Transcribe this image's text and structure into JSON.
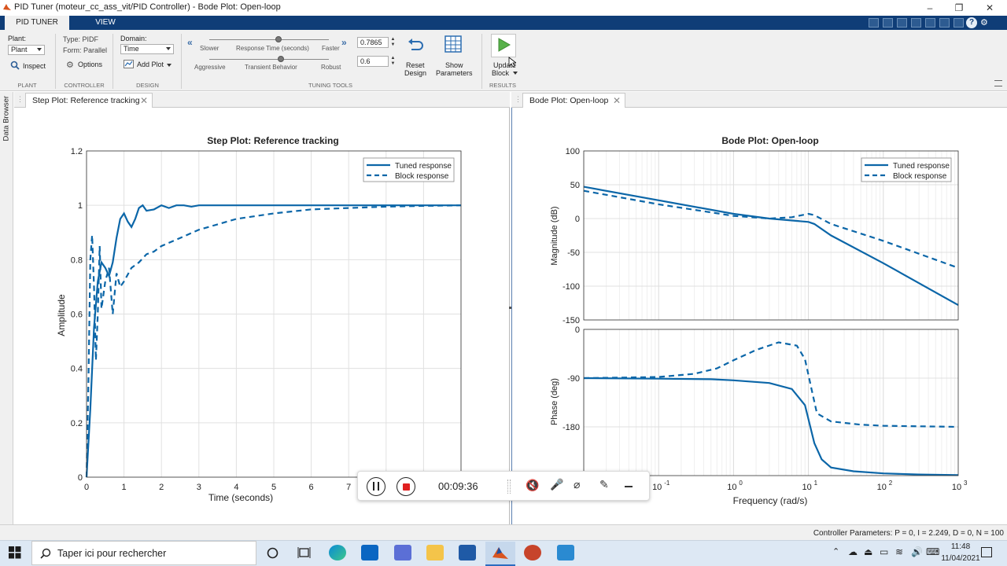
{
  "window": {
    "title": "PID Tuner (moteur_cc_ass_vit/PID Controller) - Bode Plot: Open-loop",
    "controls": [
      "–",
      "❐",
      "✕"
    ]
  },
  "ribbon": {
    "tabs": [
      "PID TUNER",
      "VIEW"
    ],
    "plant": {
      "label": "Plant:",
      "value": "Plant",
      "inspect_label": "Inspect",
      "section": "PLANT"
    },
    "controller": {
      "type_label": "Type: PIDF",
      "form_label": "Form: Parallel",
      "options_label": "Options",
      "section": "CONTROLLER"
    },
    "design": {
      "domain_label": "Domain:",
      "domain_value": "Time",
      "add_plot_label": "Add Plot",
      "section": "DESIGN"
    },
    "tuning": {
      "slower": "Slower",
      "response_time": "Response Time (seconds)",
      "faster": "Faster",
      "aggressive": "Aggressive",
      "transient": "Transient Behavior",
      "robust": "Robust",
      "response_value": "0.7865",
      "response_fraction": 0.58,
      "transient_value": "0.6",
      "transient_fraction": 0.6,
      "reset_label_1": "Reset",
      "reset_label_2": "Design",
      "show_label_1": "Show",
      "show_label_2": "Parameters",
      "section": "TUNING TOOLS"
    },
    "results": {
      "update_label_1": "Update",
      "update_label_2": "Block",
      "section": "RESULTS"
    }
  },
  "side": {
    "data_browser": "Data Browser"
  },
  "tabs": {
    "step": "Step Plot: Reference tracking",
    "bode": "Bode Plot: Open-loop"
  },
  "step_plot": {
    "title": "Step Plot: Reference tracking",
    "xlabel": "Time (seconds)",
    "ylabel": "Amplitude",
    "xticks": [
      "0",
      "1",
      "2",
      "3",
      "4",
      "5",
      "6",
      "7"
    ],
    "yticks": [
      "0",
      "0.2",
      "0.4",
      "0.6",
      "0.8",
      "1",
      "1.2"
    ],
    "legend": [
      "Tuned response",
      "Block response"
    ]
  },
  "bode_plot": {
    "title": "Bode Plot: Open-loop",
    "xlabel": "Frequency  (rad/s)",
    "mag_label": "Magnitude (dB)",
    "phase_label": "Phase (deg)",
    "mag_ticks": [
      "100",
      "50",
      "0",
      "-50",
      "-100",
      "-150"
    ],
    "phase_ticks": [
      "0",
      "-90",
      "-180"
    ],
    "legend": [
      "Tuned response",
      "Block response"
    ]
  },
  "chart_data": [
    {
      "type": "line",
      "title": "Step Plot: Reference tracking",
      "xlabel": "Time (seconds)",
      "ylabel": "Amplitude",
      "xlim": [
        0,
        10
      ],
      "ylim": [
        0,
        1.2
      ],
      "grid": true,
      "legend_position": "top-right",
      "series": [
        {
          "name": "Tuned response",
          "style": "solid",
          "x": [
            0,
            0.1,
            0.2,
            0.3,
            0.4,
            0.5,
            0.6,
            0.7,
            0.8,
            0.9,
            1.0,
            1.1,
            1.2,
            1.3,
            1.4,
            1.5,
            1.6,
            1.8,
            2.0,
            2.2,
            2.4,
            2.6,
            2.8,
            3.0,
            3.5,
            4.0,
            5.0,
            10.0
          ],
          "y": [
            0,
            0.25,
            0.55,
            0.72,
            0.79,
            0.77,
            0.74,
            0.79,
            0.88,
            0.95,
            0.97,
            0.94,
            0.92,
            0.95,
            0.99,
            1.0,
            0.98,
            0.985,
            1.0,
            0.99,
            1.0,
            1.0,
            0.995,
            1.0,
            1.0,
            1.0,
            1.0,
            1.0
          ]
        },
        {
          "name": "Block response",
          "style": "dashed",
          "x": [
            0,
            0.05,
            0.1,
            0.15,
            0.2,
            0.25,
            0.3,
            0.35,
            0.4,
            0.5,
            0.6,
            0.7,
            0.8,
            0.9,
            1.0,
            1.2,
            1.4,
            1.6,
            1.8,
            2.0,
            2.5,
            3.0,
            3.5,
            4.0,
            5.0,
            6.0,
            7.0,
            8.0,
            9.0,
            10.0
          ],
          "y": [
            0,
            0.35,
            0.8,
            0.89,
            0.7,
            0.43,
            0.6,
            0.85,
            0.62,
            0.72,
            0.77,
            0.6,
            0.75,
            0.7,
            0.72,
            0.77,
            0.79,
            0.82,
            0.83,
            0.85,
            0.88,
            0.91,
            0.93,
            0.95,
            0.97,
            0.985,
            0.99,
            0.995,
            0.998,
            1.0
          ]
        }
      ]
    },
    {
      "type": "line",
      "title": "Bode Plot: Open-loop",
      "subplot": "magnitude",
      "xlabel": "Frequency  (rad/s)",
      "ylabel": "Magnitude (dB)",
      "xscale": "log",
      "xlim": [
        0.01,
        1000
      ],
      "ylim": [
        -150,
        100
      ],
      "grid": true,
      "legend_position": "top-right",
      "series": [
        {
          "name": "Tuned response",
          "style": "solid",
          "x": [
            0.01,
            0.1,
            1,
            3,
            10,
            12,
            20,
            100,
            1000
          ],
          "y": [
            47,
            27,
            7,
            0,
            -5,
            -8,
            -25,
            -66,
            -128
          ]
        },
        {
          "name": "Block response",
          "style": "dashed",
          "x": [
            0.01,
            0.1,
            1,
            3,
            6,
            10,
            12,
            20,
            100,
            1000
          ],
          "y": [
            41,
            21,
            4,
            0,
            2,
            7,
            5,
            -8,
            -33,
            -73
          ]
        }
      ]
    },
    {
      "type": "line",
      "title": "Bode Plot: Open-loop",
      "subplot": "phase",
      "xlabel": "Frequency  (rad/s)",
      "ylabel": "Phase (deg)",
      "xscale": "log",
      "xlim": [
        0.01,
        1000
      ],
      "ylim": [
        -270,
        0
      ],
      "grid": true,
      "series": [
        {
          "name": "Tuned response",
          "style": "solid",
          "x": [
            0.01,
            0.1,
            0.5,
            1,
            3,
            6,
            9,
            12,
            15,
            20,
            40,
            100,
            300,
            1000
          ],
          "y": [
            -90,
            -91,
            -92,
            -94,
            -99,
            -110,
            -140,
            -210,
            -240,
            -255,
            -262,
            -266,
            -268,
            -269
          ]
        },
        {
          "name": "Block response",
          "style": "dashed",
          "x": [
            0.01,
            0.1,
            0.3,
            0.6,
            1,
            2,
            4,
            7,
            9,
            11,
            13,
            20,
            50,
            100,
            1000
          ],
          "y": [
            -90,
            -88,
            -82,
            -72,
            -57,
            -38,
            -24,
            -30,
            -55,
            -110,
            -155,
            -170,
            -176,
            -178,
            -180
          ]
        }
      ]
    }
  ],
  "recorder": {
    "time": "00:09:36"
  },
  "status": {
    "params": "Controller Parameters: P = 0, I = 2.249, D = 0, N = 100"
  },
  "taskbar": {
    "search_placeholder": "Taper ici pour rechercher",
    "time": "11:48",
    "date": "11/04/2021"
  },
  "colors": {
    "line": "#0b66a8",
    "ribbon_tab": "#0f3d77",
    "grid": "#e0e0e0"
  }
}
